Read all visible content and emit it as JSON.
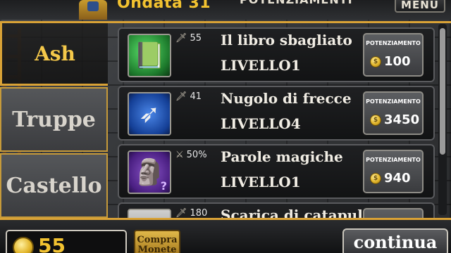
{
  "header": {
    "wave": "Ondata 31",
    "title": "POTENZIAMENTI",
    "menu_label": "MENU"
  },
  "tabs": [
    {
      "label": "Ash",
      "selected": true
    },
    {
      "label": "Truppe",
      "selected": false
    },
    {
      "label": "Castello",
      "selected": false
    }
  ],
  "upgrades": [
    {
      "name": "Il libro sbagliato",
      "level": "LIVELLO1",
      "stat": "55",
      "icon": "book-icon",
      "button_label": "POTENZIAMENTO",
      "cost": "100"
    },
    {
      "name": "Nugolo di frecce",
      "level": "LIVELLO4",
      "stat": "41",
      "icon": "arrows-icon",
      "button_label": "POTENZIAMENTO",
      "cost": "3450"
    },
    {
      "name": "Parole magiche",
      "level": "LIVELLO1",
      "stat": "50%",
      "icon": "magic-tablet-icon",
      "button_label": "POTENZIAMENTO",
      "cost": "940"
    },
    {
      "name": "Scarica di catapulta",
      "level": "",
      "stat": "180",
      "icon": "catapult-icon",
      "button_label": "",
      "cost": ""
    }
  ],
  "footer": {
    "gold": "55",
    "buy_coins_label": "Compra Monete",
    "continue_label": "continua"
  },
  "colors": {
    "accent_gold": "#d9a236",
    "gold_text": "#f2c230"
  }
}
